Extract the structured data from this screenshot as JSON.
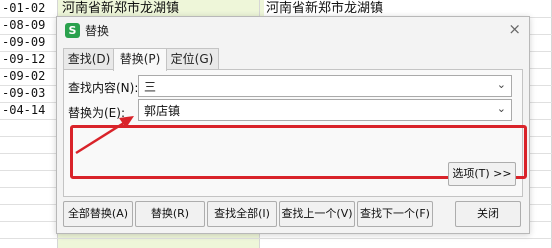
{
  "sheet": {
    "rows": [
      {
        "date": "-01-02",
        "a": "河南省新郑市龙湖镇",
        "b": "河南省新郑市龙湖镇"
      },
      {
        "date": "-08-09"
      },
      {
        "date": "-09-09"
      },
      {
        "date": "-09-12"
      },
      {
        "date": "-09-02"
      },
      {
        "date": "-09-03"
      },
      {
        "date": "-04-14"
      }
    ]
  },
  "dialog": {
    "title": "替换",
    "app_icon": "S",
    "close": "×",
    "tabs": [
      {
        "label": "查找(D)",
        "active": false
      },
      {
        "label": "替换(P)",
        "active": true
      },
      {
        "label": "定位(G)",
        "active": false
      }
    ],
    "find_label": "查找内容(N):",
    "find_value": "三",
    "replace_label": "替换为(E):",
    "replace_value": "郭店镇",
    "options_button": "选项(T) >>",
    "buttons": [
      {
        "label": "全部替换(A)"
      },
      {
        "label": "替换(R)"
      },
      {
        "label": "查找全部(I)"
      },
      {
        "label": "查找上一个(V)"
      },
      {
        "label": "查找下一个(F)"
      }
    ],
    "close_button": "关闭"
  },
  "colors": {
    "highlight": "#d9232a",
    "cell_fill": "#eef6d9",
    "accent": "#2aa14d"
  }
}
